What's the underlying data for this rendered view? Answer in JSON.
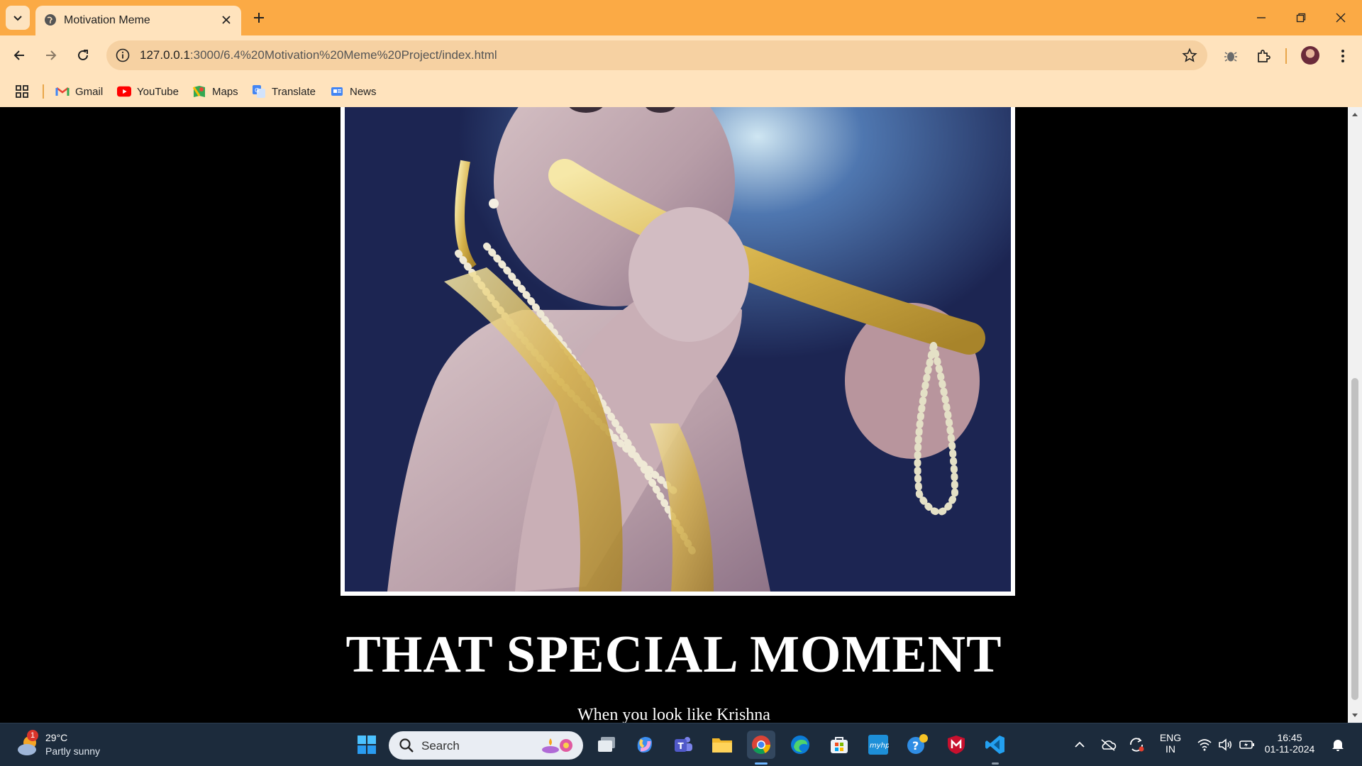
{
  "browser": {
    "tab_title": "Motivation Meme",
    "url_host": "127.0.0.1",
    "url_rest": ":3000/6.4%20Motivation%20Meme%20Project/index.html",
    "bookmarks": [
      {
        "label": "Gmail"
      },
      {
        "label": "YouTube"
      },
      {
        "label": "Maps"
      },
      {
        "label": "Translate"
      },
      {
        "label": "News"
      }
    ]
  },
  "page": {
    "meme_title": "THAT SPECIAL MOMENT",
    "meme_caption": "When you look like Krishna"
  },
  "taskbar": {
    "weather_temp": "29°C",
    "weather_desc": "Partly sunny",
    "weather_badge": "1",
    "search_label": "Search",
    "lang_1": "ENG",
    "lang_2": "IN",
    "time": "16:45",
    "date": "01-11-2024"
  },
  "colors": {
    "tabstrip": "#fbaa45",
    "toolbar": "#ffe3bd",
    "page_bg": "#000000",
    "taskbar": "#1c2b3c"
  }
}
